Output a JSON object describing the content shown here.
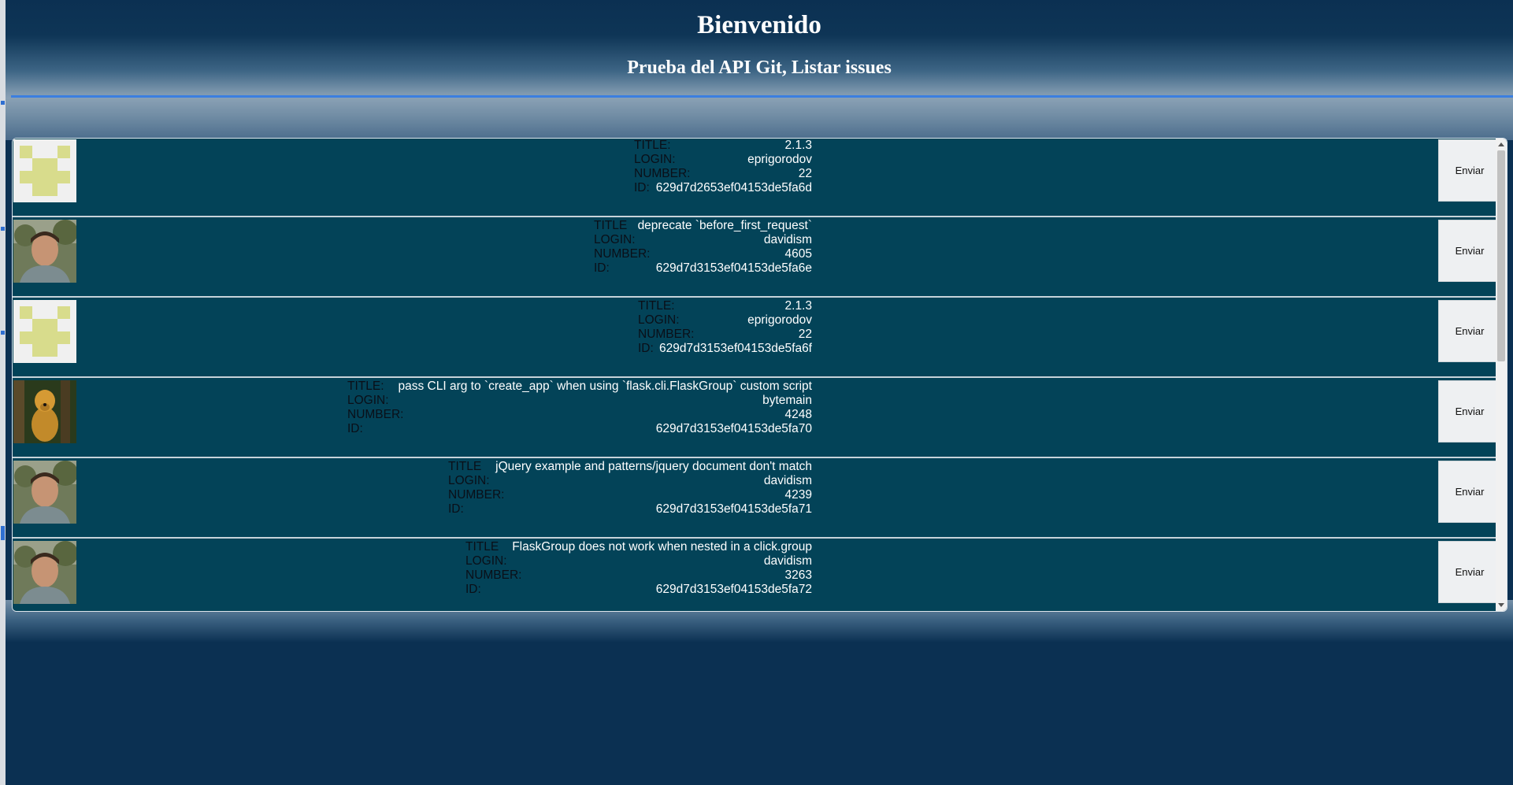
{
  "header": {
    "title": "Bienvenido",
    "subtitle": "Prueba del API Git, Listar issues"
  },
  "issues": [
    {
      "avatar": "identicon-avatar",
      "title_label": "TITLE:",
      "title": "2.1.3",
      "login_label": "LOGIN:",
      "login": "eprigorodov",
      "number_label": "NUMBER:",
      "number": "22",
      "id_label": "ID:",
      "id": "629d7d2653ef04153de5fa6d",
      "button": "Enviar"
    },
    {
      "avatar": "photo-avatar-man",
      "title_label": "TITLE",
      "title": "deprecate `before_first_request`",
      "login_label": "LOGIN:",
      "login": "davidism",
      "number_label": "NUMBER:",
      "number": "4605",
      "id_label": "ID:",
      "id": "629d7d3153ef04153de5fa6e",
      "button": "Enviar"
    },
    {
      "avatar": "identicon-avatar",
      "title_label": "TITLE:",
      "title": "2.1.3",
      "login_label": "LOGIN:",
      "login": "eprigorodov",
      "number_label": "NUMBER:",
      "number": "22",
      "id_label": "ID:",
      "id": "629d7d3153ef04153de5fa6f",
      "button": "Enviar"
    },
    {
      "avatar": "photo-avatar-dog",
      "title_label": "TITLE:",
      "title": "pass CLI arg to `create_app` when using `flask.cli.FlaskGroup` custom script",
      "login_label": "LOGIN:",
      "login": "bytemain",
      "number_label": "NUMBER:",
      "number": "4248",
      "id_label": "ID:",
      "id": "629d7d3153ef04153de5fa70",
      "button": "Enviar"
    },
    {
      "avatar": "photo-avatar-man",
      "title_label": "TITLE",
      "title": "jQuery example and patterns/jquery document don't match",
      "login_label": "LOGIN:",
      "login": "davidism",
      "number_label": "NUMBER:",
      "number": "4239",
      "id_label": "ID:",
      "id": "629d7d3153ef04153de5fa71",
      "button": "Enviar"
    },
    {
      "avatar": "photo-avatar-man",
      "title_label": "TITLE",
      "title": "FlaskGroup does not work when nested in a click.group",
      "login_label": "LOGIN:",
      "login": "davidism",
      "number_label": "NUMBER:",
      "number": "3263",
      "id_label": "ID:",
      "id": "629d7d3153ef04153de5fa72",
      "button": "Enviar"
    }
  ],
  "colors": {
    "page_background": "#0b3052",
    "row_background": "#034358",
    "accent_rule": "#3b7fe0",
    "identicon_fill": "#d8dc8c"
  }
}
